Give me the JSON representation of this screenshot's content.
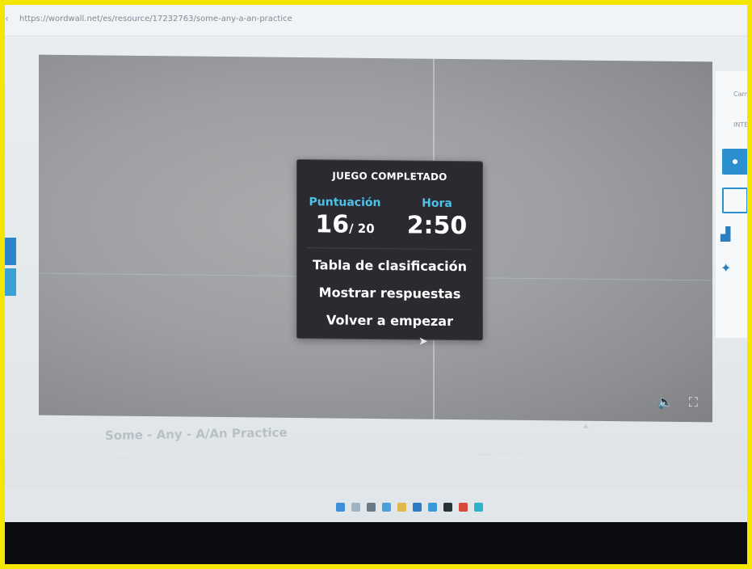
{
  "browser": {
    "url": "https://wordwall.net/es/resource/17232763/some-any-a-an-practice"
  },
  "game": {
    "result": {
      "title": "JUEGO COMPLETADO",
      "score_label": "Puntuación",
      "score_value": "16",
      "score_total": "/ 20",
      "time_label": "Hora",
      "time_value": "2:50",
      "menu": [
        {
          "label": "Tabla de clasificación"
        },
        {
          "label": "Mostrar respuestas"
        },
        {
          "label": "Volver a empezar"
        }
      ]
    },
    "controls": {
      "sound_icon": "speaker-icon",
      "fullscreen_icon": "fullscreen-icon"
    },
    "title": "Some - Any - A/An Practice"
  },
  "right_panel": {
    "header_text": "Cam",
    "section_text": "INTER"
  },
  "colors": {
    "accent_blue": "#4dc2e8",
    "panel_bg": "#2c2a31",
    "frame_border": "#f5e600"
  }
}
